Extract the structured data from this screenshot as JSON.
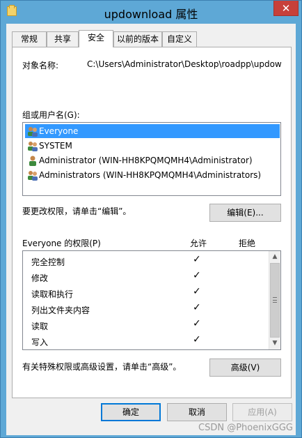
{
  "window": {
    "title": "updownload 属性",
    "close_glyph": "✕"
  },
  "tabs": [
    {
      "label": "常规",
      "active": false
    },
    {
      "label": "共享",
      "active": false
    },
    {
      "label": "安全",
      "active": true
    },
    {
      "label": "以前的版本",
      "active": false
    },
    {
      "label": "自定义",
      "active": false
    }
  ],
  "security": {
    "object_name_label": "对象名称:",
    "object_name_value": "C:\\Users\\Administrator\\Desktop\\roadpp\\updow",
    "group_label": "组或用户名(G):",
    "users": [
      {
        "name": "Everyone",
        "icon": "group-icon",
        "selected": true
      },
      {
        "name": "SYSTEM",
        "icon": "group-icon",
        "selected": false
      },
      {
        "name": "Administrator (WIN-HH8KPQMQMH4\\Administrator)",
        "icon": "user-icon",
        "selected": false
      },
      {
        "name": "Administrators (WIN-HH8KPQMQMH4\\Administrators)",
        "icon": "group-icon",
        "selected": false
      }
    ],
    "edit_hint": "要更改权限，请单击“编辑”。",
    "edit_button": "编辑(E)...",
    "perm_header": "Everyone 的权限(P)",
    "allow_header": "允许",
    "deny_header": "拒绝",
    "permissions": [
      {
        "name": "完全控制",
        "allow": "✓",
        "deny": ""
      },
      {
        "name": "修改",
        "allow": "✓",
        "deny": ""
      },
      {
        "name": "读取和执行",
        "allow": "✓",
        "deny": ""
      },
      {
        "name": "列出文件夹内容",
        "allow": "✓",
        "deny": ""
      },
      {
        "name": "读取",
        "allow": "✓",
        "deny": ""
      },
      {
        "name": "写入",
        "allow": "✓",
        "deny": ""
      }
    ],
    "advanced_hint": "有关特殊权限或高级设置，请单击“高级”。",
    "advanced_button": "高级(V)"
  },
  "footer": {
    "ok": "确定",
    "cancel": "取消",
    "apply": "应用(A)"
  },
  "watermark": "CSDN @PhoenixGGG"
}
